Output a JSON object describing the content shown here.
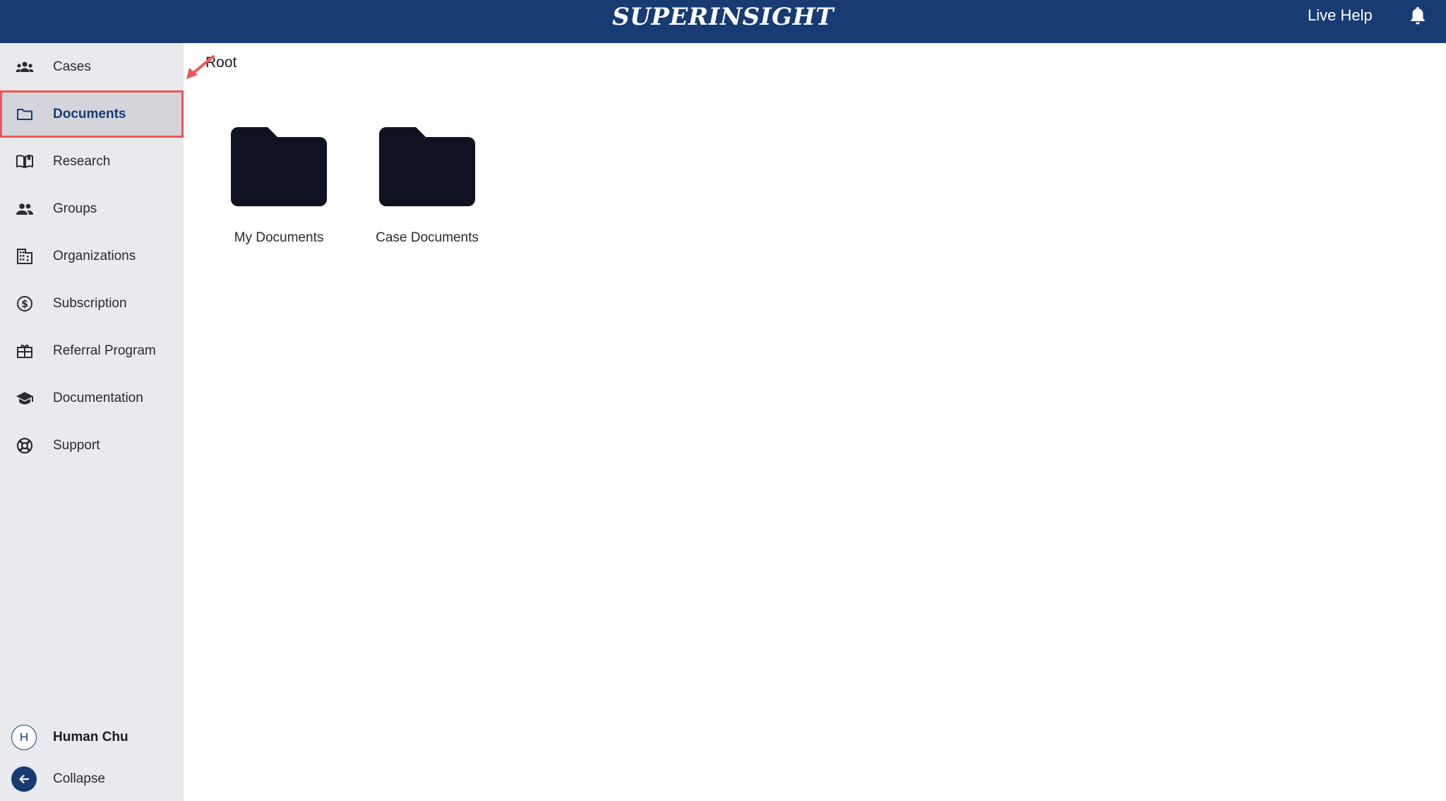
{
  "header": {
    "brand": "SUPERINSIGHT",
    "live_help": "Live Help",
    "background_color": "#173b72",
    "notification_icon": "bell-icon"
  },
  "sidebar": {
    "items": [
      {
        "label": "Cases",
        "icon": "people-group-icon",
        "active": false
      },
      {
        "label": "Documents",
        "icon": "folder-outline-icon",
        "active": true
      },
      {
        "label": "Research",
        "icon": "book-open-icon",
        "active": false
      },
      {
        "label": "Groups",
        "icon": "people-icon",
        "active": false
      },
      {
        "label": "Organizations",
        "icon": "building-icon",
        "active": false
      },
      {
        "label": "Subscription",
        "icon": "dollar-circle-icon",
        "active": false
      },
      {
        "label": "Referral Program",
        "icon": "gift-card-icon",
        "active": false
      },
      {
        "label": "Documentation",
        "icon": "graduation-cap-icon",
        "active": false
      },
      {
        "label": "Support",
        "icon": "lifebuoy-icon",
        "active": false
      }
    ],
    "user": {
      "initial": "H",
      "name": "Human Chu"
    },
    "collapse_label": "Collapse",
    "highlight_color": "#ef5757"
  },
  "main": {
    "breadcrumb": "Root",
    "folders": [
      {
        "label": "My Documents",
        "icon": "folder-icon"
      },
      {
        "label": "Case Documents",
        "icon": "folder-icon"
      }
    ]
  }
}
